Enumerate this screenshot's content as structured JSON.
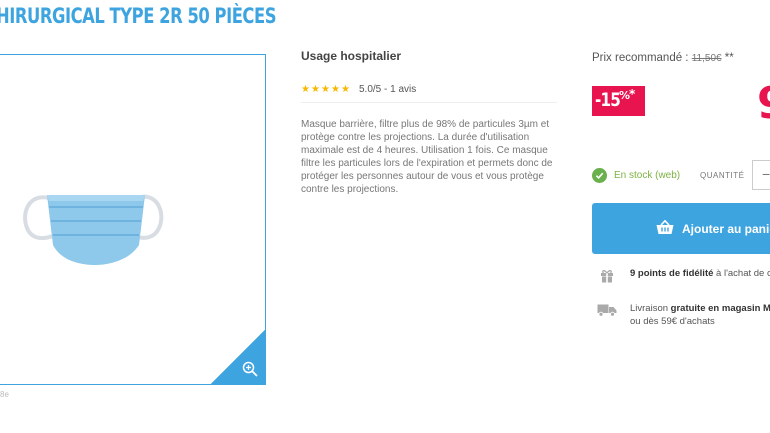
{
  "product": {
    "title": "HIRURGICAL TYPE 2R 50 PIÈCES",
    "reference": "8e"
  },
  "details": {
    "usage": "Usage hospitalier",
    "rating_text": "5.0/5 - 1 avis",
    "stars": 5,
    "description": "Masque barrière, filtre plus de 98% de particules 3µm et protège contre les projections. La durée d'utilisation maximale est de 4 heures. Utilisation 1 fois. Ce masque filtre les particules lors de l'expiration et permets donc de protéger les personnes autour de vous et vous protège contre les projections."
  },
  "pricing": {
    "recommended_label": "Prix recommandé :",
    "recommended_price": "11,50€",
    "recommended_suffix": "**",
    "discount_number": "-15",
    "discount_percent": "%",
    "discount_asterisk": "*",
    "price_partial": "9"
  },
  "purchase": {
    "stock_text": "En stock (web)",
    "quantity_label": "QUANTITÉ",
    "minus_label": "−",
    "add_to_cart_label": "Ajouter au panier"
  },
  "loyalty": {
    "points_bold": "9 points de fidélité",
    "points_rest": " à l'achat de c"
  },
  "delivery": {
    "prefix": "Livraison ",
    "bold": "gratuite en magasin M",
    "line2": "ou dès 59€ d'achats"
  },
  "icons": {
    "zoom": "zoom-in-icon",
    "check": "check-icon",
    "cart": "basket-icon",
    "gift": "gift-icon",
    "truck": "truck-icon"
  },
  "colors": {
    "brand_blue": "#3ea4e0",
    "discount_red": "#e8144f",
    "stock_green": "#6ab04c",
    "star_yellow": "#f6b800"
  }
}
